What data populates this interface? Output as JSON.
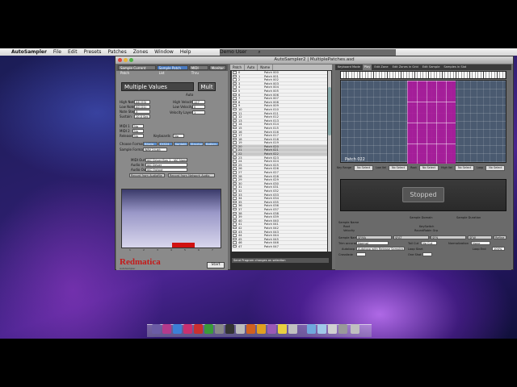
{
  "menubar": {
    "apple": "",
    "app": "AutoSampler",
    "items": [
      "File",
      "Edit",
      "Presets",
      "Patches",
      "Zones",
      "Window",
      "Help"
    ],
    "user": "Demo User"
  },
  "window": {
    "title": "AutoSampler2 | MultiplePatches.asd"
  },
  "left": {
    "tabs": [
      "Sample Current Patch",
      "Sample Patch List",
      "MIDI Thru",
      "Monitor"
    ],
    "name_value": "Multiple Values",
    "mult_label": "Mult",
    "auto_label": "Auto",
    "rows": [
      {
        "label": "High Note",
        "value": "A6 (93)"
      },
      {
        "label": "Low Note",
        "value": "A0 (21)"
      },
      {
        "label": "Note Step",
        "value": "3"
      },
      {
        "label": "Sustain",
        "value": "10.0 Sec"
      }
    ],
    "right_rows": [
      {
        "label": "High Velocity",
        "value": "127"
      },
      {
        "label": "Low Velocity",
        "value": "0"
      },
      {
        "label": "Velocity Layers",
        "value": "1"
      }
    ],
    "midi": [
      {
        "label": "MIDI 1",
        "value": "No"
      },
      {
        "label": "MIDI 2",
        "value": "No"
      },
      {
        "label": "Release",
        "value": "No"
      },
      {
        "label": "Keyboards",
        "value": "No"
      }
    ],
    "choose_format": "Choose Format",
    "formats": [
      "Bitwig",
      "EXS24",
      "Kontakt",
      "Structure",
      "Battery"
    ],
    "sample_format_label": "Sample Format",
    "sample_format": "WAV 24-bit",
    "midi_out_label": "MIDI Out",
    "midi_out": "IAC Driver Bus 1 - IAC Name",
    "audio_in_label": "Audio In",
    "audio_in": "IAC Driver",
    "audio_out_label": "Audio Out",
    "audio_out": "IAC Output",
    "record_btn": "Record from Audiofile",
    "record_btn2": "Record from Network Audio",
    "graph_axis": [
      "1",
      "2",
      "3",
      "4",
      "5",
      "6",
      "7"
    ],
    "logo": "Redmatica",
    "logo_sub": "AutoSampler",
    "start_label": "Start"
  },
  "list": {
    "headers": [
      "Patch",
      "Auto",
      "Name"
    ],
    "footer": "Send Program changes on selection",
    "rows": [
      {
        "num": "0",
        "name": "Patch 000"
      },
      {
        "num": "1",
        "name": "Patch 001"
      },
      {
        "num": "2",
        "name": "Patch 002"
      },
      {
        "num": "3",
        "name": "Patch 003"
      },
      {
        "num": "4",
        "name": "Patch 004"
      },
      {
        "num": "5",
        "name": "Patch 005"
      },
      {
        "num": "6",
        "name": "Patch 006"
      },
      {
        "num": "7",
        "name": "Patch 007"
      },
      {
        "num": "8",
        "name": "Patch 008"
      },
      {
        "num": "9",
        "name": "Patch 009"
      },
      {
        "num": "10",
        "name": "Patch 010"
      },
      {
        "num": "11",
        "name": "Patch 011"
      },
      {
        "num": "12",
        "name": "Patch 012"
      },
      {
        "num": "13",
        "name": "Patch 013"
      },
      {
        "num": "14",
        "name": "Patch 014"
      },
      {
        "num": "15",
        "name": "Patch 015"
      },
      {
        "num": "16",
        "name": "Patch 016"
      },
      {
        "num": "17",
        "name": "Patch 017"
      },
      {
        "num": "18",
        "name": "Patch 018"
      },
      {
        "num": "19",
        "name": "Patch 019"
      },
      {
        "num": "20",
        "name": "Patch 020"
      },
      {
        "num": "21",
        "name": "Patch 021"
      },
      {
        "num": "22",
        "name": "Patch 022"
      },
      {
        "num": "23",
        "name": "Patch 023"
      },
      {
        "num": "24",
        "name": "Patch 024"
      },
      {
        "num": "25",
        "name": "Patch 025"
      },
      {
        "num": "26",
        "name": "Patch 026"
      },
      {
        "num": "27",
        "name": "Patch 027"
      },
      {
        "num": "28",
        "name": "Patch 028"
      },
      {
        "num": "29",
        "name": "Patch 029"
      },
      {
        "num": "30",
        "name": "Patch 030"
      },
      {
        "num": "31",
        "name": "Patch 031"
      },
      {
        "num": "32",
        "name": "Patch 032"
      },
      {
        "num": "33",
        "name": "Patch 033"
      },
      {
        "num": "34",
        "name": "Patch 034"
      },
      {
        "num": "35",
        "name": "Patch 035"
      },
      {
        "num": "36",
        "name": "Patch 036"
      },
      {
        "num": "37",
        "name": "Patch 037"
      },
      {
        "num": "38",
        "name": "Patch 038"
      },
      {
        "num": "39",
        "name": "Patch 039"
      },
      {
        "num": "40",
        "name": "Patch 040"
      },
      {
        "num": "41",
        "name": "Patch 041"
      },
      {
        "num": "42",
        "name": "Patch 042"
      },
      {
        "num": "43",
        "name": "Patch 043"
      },
      {
        "num": "44",
        "name": "Patch 044"
      },
      {
        "num": "45",
        "name": "Patch 045"
      },
      {
        "num": "46",
        "name": "Patch 046"
      },
      {
        "num": "47",
        "name": "Patch 047"
      }
    ],
    "highlight_rows": [
      20,
      21,
      22
    ]
  },
  "right": {
    "tabs": [
      "Keyboard Mode",
      "Play",
      "Edit Zone",
      "Edit Zones in Grid",
      "Edit Sample",
      "Samples in Slot"
    ],
    "zone_label": "Patch 022",
    "filters": [
      "Key Range",
      "No Select",
      "Low Vel",
      "No Select",
      "Root",
      "No Select",
      "High Vel",
      "No Select",
      "Loop",
      "No Select"
    ],
    "status": "Stopped",
    "info": {
      "h1": "Sample Domain",
      "h2": "Sample Duration",
      "sample_name_label": "Sample Name",
      "root_label": "Root",
      "velocity_label": "Velocity",
      "keyswitch_label": "KeySwitch",
      "roundrobin_label": "RoundRobin Grp",
      "sample_name_btns": [
        "SFMA",
        "SFAT",
        "SFN",
        "SFW"
      ],
      "trim_label": "Trim accuracy",
      "trim_value": "Normal",
      "pitch_label": "Normalization",
      "pitch_value": "None",
      "autoloop_label": "Autoloop",
      "autoloop_value": "Autoloop with Release Samples",
      "loop_start_label": "Loop Start",
      "loop_end_label": "Loop End",
      "xfade_label": "Crossfade",
      "oneshot_label": "One Shot",
      "tail_label": "Tail Cut",
      "tail_value": "No Cut",
      "refine_label": "Refine",
      "percent": "100%"
    }
  }
}
